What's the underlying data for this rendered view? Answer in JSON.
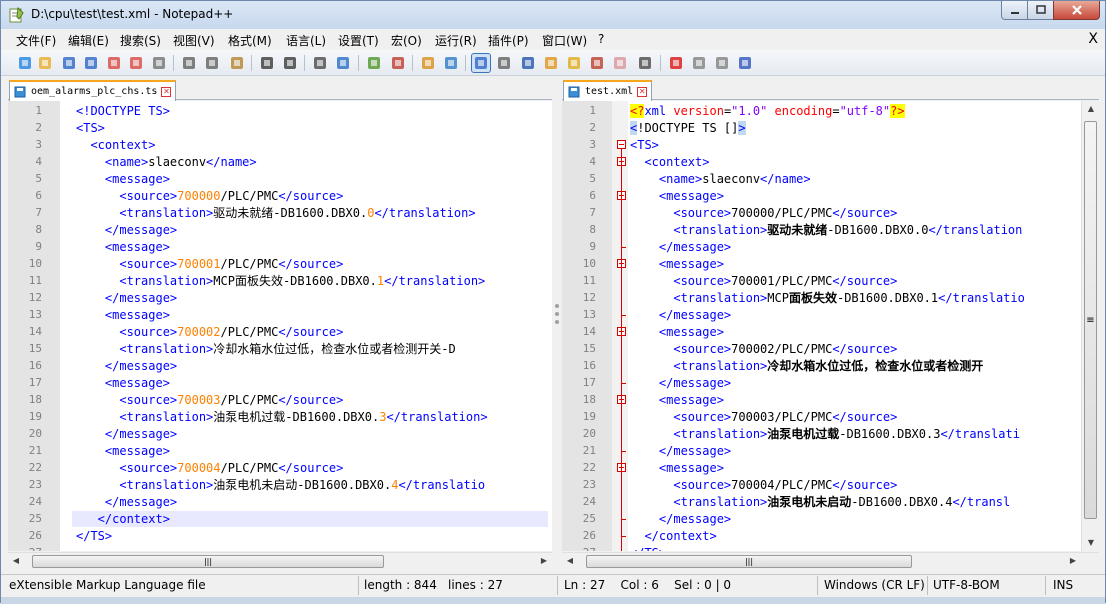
{
  "window": {
    "title": "D:\\cpu\\test\\test.xml - Notepad++"
  },
  "menu": {
    "items": [
      "文件(F)",
      "编辑(E)",
      "搜索(S)",
      "视图(V)",
      "格式(M)",
      "语言(L)",
      "设置(T)",
      "宏(O)",
      "运行(R)",
      "插件(P)",
      "窗口(W)",
      "?"
    ],
    "close_label": "X"
  },
  "toolbar": {
    "icons": [
      "new-icon",
      "open-icon",
      "save-icon",
      "save-all-icon",
      "close-icon",
      "close-all-icon",
      "print-icon",
      "cut-icon",
      "copy-icon",
      "paste-icon",
      "undo-icon",
      "redo-icon",
      "find-icon",
      "replace-icon",
      "zoom-in-icon",
      "zoom-out-icon",
      "sync-vertical-icon",
      "sync-horizontal-icon",
      "word-wrap-icon",
      "show-all-chars-icon",
      "indent-guide-icon",
      "doc-map-icon",
      "function-list-icon",
      "folder-as-workspace-icon",
      "monitor-icon",
      "record-macro-icon",
      "stop-record-icon",
      "play-macro-icon",
      "run-macro-multiple-icon",
      "save-macro-icon"
    ]
  },
  "left_pane": {
    "tab_label": "oem_alarms_plc_chs.ts",
    "lines": [
      [
        {
          "t": "<!DOCTYPE TS>",
          "c": "tag"
        }
      ],
      [
        {
          "t": "<TS>",
          "c": "tag"
        }
      ],
      [
        {
          "t": "  <context>",
          "c": "tag"
        }
      ],
      [
        {
          "t": "    <name>",
          "c": "tag"
        },
        {
          "t": "slaeconv",
          "c": "txt"
        },
        {
          "t": "</name>",
          "c": "tag"
        }
      ],
      [
        {
          "t": "    <message>",
          "c": "tag"
        }
      ],
      [
        {
          "t": "      <source>",
          "c": "tag"
        },
        {
          "t": "700000",
          "c": "num"
        },
        {
          "t": "/PLC/PMC",
          "c": "txt"
        },
        {
          "t": "</source>",
          "c": "tag"
        }
      ],
      [
        {
          "t": "      <translation>",
          "c": "tag"
        },
        {
          "t": "驱动未就绪-DB1600.DBX0.",
          "c": "txt"
        },
        {
          "t": "0",
          "c": "num"
        },
        {
          "t": "</translation>",
          "c": "tag"
        }
      ],
      [
        {
          "t": "    </message>",
          "c": "tag"
        }
      ],
      [
        {
          "t": "    <message>",
          "c": "tag"
        }
      ],
      [
        {
          "t": "      <source>",
          "c": "tag"
        },
        {
          "t": "700001",
          "c": "num"
        },
        {
          "t": "/PLC/PMC",
          "c": "txt"
        },
        {
          "t": "</source>",
          "c": "tag"
        }
      ],
      [
        {
          "t": "      <translation>",
          "c": "tag"
        },
        {
          "t": "MCP面板失效-DB1600.DBX0.",
          "c": "txt"
        },
        {
          "t": "1",
          "c": "num"
        },
        {
          "t": "</translation>",
          "c": "tag"
        }
      ],
      [
        {
          "t": "    </message>",
          "c": "tag"
        }
      ],
      [
        {
          "t": "    <message>",
          "c": "tag"
        }
      ],
      [
        {
          "t": "      <source>",
          "c": "tag"
        },
        {
          "t": "700002",
          "c": "num"
        },
        {
          "t": "/PLC/PMC",
          "c": "txt"
        },
        {
          "t": "</source>",
          "c": "tag"
        }
      ],
      [
        {
          "t": "      <translation>",
          "c": "tag"
        },
        {
          "t": "冷却水箱水位过低，检查水位或者检测开关-D",
          "c": "txt"
        }
      ],
      [
        {
          "t": "    </message>",
          "c": "tag"
        }
      ],
      [
        {
          "t": "    <message>",
          "c": "tag"
        }
      ],
      [
        {
          "t": "      <source>",
          "c": "tag"
        },
        {
          "t": "700003",
          "c": "num"
        },
        {
          "t": "/PLC/PMC",
          "c": "txt"
        },
        {
          "t": "</source>",
          "c": "tag"
        }
      ],
      [
        {
          "t": "      <translation>",
          "c": "tag"
        },
        {
          "t": "油泵电机过载-DB1600.DBX0.",
          "c": "txt"
        },
        {
          "t": "3",
          "c": "num"
        },
        {
          "t": "</translation>",
          "c": "tag"
        }
      ],
      [
        {
          "t": "    </message>",
          "c": "tag"
        }
      ],
      [
        {
          "t": "    <message>",
          "c": "tag"
        }
      ],
      [
        {
          "t": "      <source>",
          "c": "tag"
        },
        {
          "t": "700004",
          "c": "num"
        },
        {
          "t": "/PLC/PMC",
          "c": "txt"
        },
        {
          "t": "</source>",
          "c": "tag"
        }
      ],
      [
        {
          "t": "      <translation>",
          "c": "tag"
        },
        {
          "t": "油泵电机未启动-DB1600.DBX0.",
          "c": "txt"
        },
        {
          "t": "4",
          "c": "num"
        },
        {
          "t": "</translatio",
          "c": "tag"
        }
      ],
      [
        {
          "t": "    </message>",
          "c": "tag"
        }
      ],
      [
        {
          "t": "   </context>",
          "c": "tag"
        }
      ],
      [
        {
          "t": "</TS>",
          "c": "tag"
        }
      ],
      []
    ],
    "highlight_line": 25,
    "scroll_arrow_left": "◀",
    "scroll_arrow_right": "▶",
    "scroll_grip": "|||"
  },
  "right_pane": {
    "tab_label": "test.xml",
    "lines": [
      [
        {
          "t": "<?",
          "c": "tag pi"
        },
        {
          "t": "xml ",
          "c": "tag"
        },
        {
          "t": "version",
          "c": "attr"
        },
        {
          "t": "=",
          "c": "txt"
        },
        {
          "t": "\"1.0\"",
          "c": "aval"
        },
        {
          "t": " ",
          "c": "txt"
        },
        {
          "t": "encoding",
          "c": "attr"
        },
        {
          "t": "=",
          "c": "txt"
        },
        {
          "t": "\"utf-8\"",
          "c": "aval"
        },
        {
          "t": "?>",
          "c": "tag pi"
        }
      ],
      [
        {
          "t": "<",
          "c": "tag br"
        },
        {
          "t": "!DOCTYPE TS []",
          "c": "txt"
        },
        {
          "t": ">",
          "c": "tag br"
        }
      ],
      [
        {
          "t": "<TS>",
          "c": "tag"
        }
      ],
      [
        {
          "t": "  <context>",
          "c": "tag"
        }
      ],
      [
        {
          "t": "    <name>",
          "c": "tag"
        },
        {
          "t": "slaeconv",
          "c": "txt"
        },
        {
          "t": "</name>",
          "c": "tag"
        }
      ],
      [
        {
          "t": "    <message>",
          "c": "tag"
        }
      ],
      [
        {
          "t": "      <source>",
          "c": "tag"
        },
        {
          "t": "700000/PLC/PMC",
          "c": "txt"
        },
        {
          "t": "</source>",
          "c": "tag"
        }
      ],
      [
        {
          "t": "      <translation>",
          "c": "tag"
        },
        {
          "t": "驱动未就绪",
          "c": "txt bold"
        },
        {
          "t": "-DB1600.DBX0.0",
          "c": "txt"
        },
        {
          "t": "</translation",
          "c": "tag"
        }
      ],
      [
        {
          "t": "    </message>",
          "c": "tag"
        }
      ],
      [
        {
          "t": "    <message>",
          "c": "tag"
        }
      ],
      [
        {
          "t": "      <source>",
          "c": "tag"
        },
        {
          "t": "700001/PLC/PMC",
          "c": "txt"
        },
        {
          "t": "</source>",
          "c": "tag"
        }
      ],
      [
        {
          "t": "      <translation>",
          "c": "tag"
        },
        {
          "t": "MCP",
          "c": "txt"
        },
        {
          "t": "面板失效",
          "c": "txt bold"
        },
        {
          "t": "-DB1600.DBX0.1",
          "c": "txt"
        },
        {
          "t": "</translatio",
          "c": "tag"
        }
      ],
      [
        {
          "t": "    </message>",
          "c": "tag"
        }
      ],
      [
        {
          "t": "    <message>",
          "c": "tag"
        }
      ],
      [
        {
          "t": "      <source>",
          "c": "tag"
        },
        {
          "t": "700002/PLC/PMC",
          "c": "txt"
        },
        {
          "t": "</source>",
          "c": "tag"
        }
      ],
      [
        {
          "t": "      <translation>",
          "c": "tag"
        },
        {
          "t": "冷却水箱水位过低，检查水位或者检测开",
          "c": "txt bold"
        }
      ],
      [
        {
          "t": "    </message>",
          "c": "tag"
        }
      ],
      [
        {
          "t": "    <message>",
          "c": "tag"
        }
      ],
      [
        {
          "t": "      <source>",
          "c": "tag"
        },
        {
          "t": "700003/PLC/PMC",
          "c": "txt"
        },
        {
          "t": "</source>",
          "c": "tag"
        }
      ],
      [
        {
          "t": "      <translation>",
          "c": "tag"
        },
        {
          "t": "油泵电机过载",
          "c": "txt bold"
        },
        {
          "t": "-DB1600.DBX0.3",
          "c": "txt"
        },
        {
          "t": "</translati",
          "c": "tag"
        }
      ],
      [
        {
          "t": "    </message>",
          "c": "tag"
        }
      ],
      [
        {
          "t": "    <message>",
          "c": "tag"
        }
      ],
      [
        {
          "t": "      <source>",
          "c": "tag"
        },
        {
          "t": "700004/PLC/PMC",
          "c": "txt"
        },
        {
          "t": "</source>",
          "c": "tag"
        }
      ],
      [
        {
          "t": "      <translation>",
          "c": "tag"
        },
        {
          "t": "油泵电机未启动",
          "c": "txt bold"
        },
        {
          "t": "-DB1600.DBX0.4",
          "c": "txt"
        },
        {
          "t": "</transl",
          "c": "tag"
        }
      ],
      [
        {
          "t": "    </message>",
          "c": "tag"
        }
      ],
      [
        {
          "t": "  </context>",
          "c": "tag"
        }
      ],
      [
        {
          "t": "</TS>",
          "c": "tag"
        }
      ]
    ],
    "fold_open_lines": [
      3,
      4,
      6,
      10,
      14,
      18,
      22
    ],
    "scroll_arrow_left": "◀",
    "scroll_arrow_right": "▶",
    "scroll_arrow_up": "▲",
    "scroll_arrow_down": "▼",
    "scroll_grip": "|||",
    "vscroll_grip": "≡"
  },
  "statusbar": {
    "file_type": "eXtensible Markup Language file",
    "length": "length : 844",
    "lines": "lines : 27",
    "position": "Ln : 27    Col : 6    Sel : 0 | 0",
    "eol": "Windows (CR LF)",
    "encoding": "UTF-8-BOM",
    "mode": "INS"
  },
  "colors": {
    "tag": "#0000ff",
    "number": "#ff8000",
    "attr": "#ff0000",
    "attr_value": "#8000ff",
    "tab_accent": "#f6a71e",
    "current_line": "#e8e8ff"
  }
}
